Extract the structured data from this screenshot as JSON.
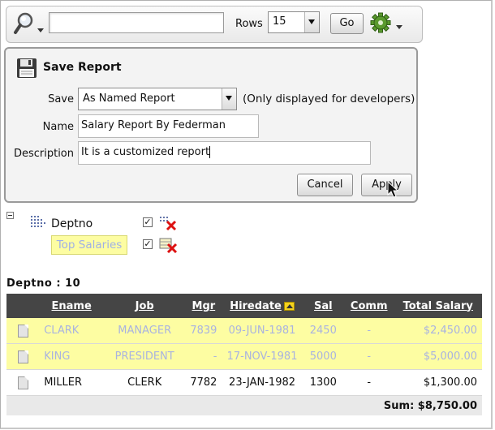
{
  "toolbar": {
    "search_value": "",
    "rows_label": "Rows",
    "rows_value": "15",
    "go_label": "Go"
  },
  "save_report": {
    "title": "Save Report",
    "save_label": "Save",
    "save_value": "As Named Report",
    "save_note": "(Only displayed for developers)",
    "name_label": "Name",
    "name_value": "Salary Report By Federman",
    "description_label": "Description",
    "description_value": "It is a customized report",
    "cancel_label": "Cancel",
    "apply_label": "Apply"
  },
  "filters": {
    "group_label": "Deptno",
    "highlight_label": "Top Salaries"
  },
  "report": {
    "break_label": "Deptno : 10",
    "columns": [
      "Ename",
      "Job",
      "Mgr",
      "Hiredate",
      "Sal",
      "Comm",
      "Total Salary"
    ],
    "rows": [
      {
        "ename": "CLARK",
        "job": "MANAGER",
        "mgr": "7839",
        "hiredate": "09-JUN-1981",
        "sal": "2450",
        "comm": "-",
        "total": "$2,450.00",
        "highlight": true
      },
      {
        "ename": "KING",
        "job": "PRESIDENT",
        "mgr": "-",
        "hiredate": "17-NOV-1981",
        "sal": "5000",
        "comm": "-",
        "total": "$5,000.00",
        "highlight": true
      },
      {
        "ename": "MILLER",
        "job": "CLERK",
        "mgr": "7782",
        "hiredate": "23-JAN-1982",
        "sal": "1300",
        "comm": "-",
        "total": "$1,300.00",
        "highlight": false
      }
    ],
    "sum_label": "Sum: $8,750.00"
  },
  "colors": {
    "highlight_row": "#fdfda2",
    "highlight_text": "#a9b3e0",
    "header_bg": "#454545",
    "panel_bg": "#f3f3f3"
  }
}
